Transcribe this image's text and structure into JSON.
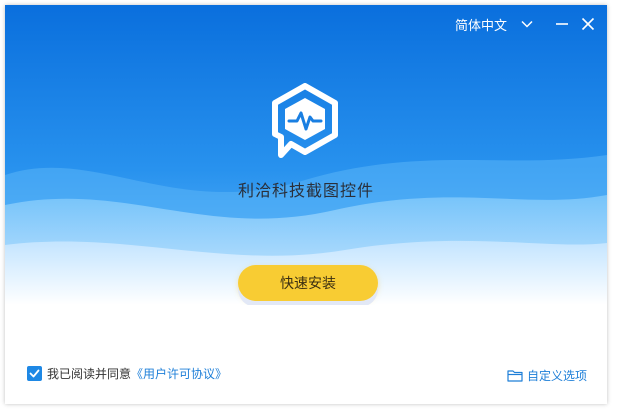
{
  "window": {
    "language_label": "简体中文"
  },
  "product": {
    "name": "利洽科技截图控件"
  },
  "actions": {
    "install_label": "快速安装",
    "custom_label": "自定义选项"
  },
  "agreement": {
    "checked": true,
    "prefix": "我已阅读并同意",
    "link_label": "《用户许可协议》"
  },
  "colors": {
    "hero_top": "#0a74e0",
    "hero_bottom": "#3ba3f4",
    "install_button": "#f8cc33",
    "link": "#1e7fd8",
    "checkbox": "#1e88e5"
  },
  "icons": {
    "language_dropdown": "chevron-down-icon",
    "minimize": "minimize-icon",
    "close": "close-icon",
    "logo": "app-logo-icon",
    "checkbox": "checkmark-icon",
    "custom": "folder-icon"
  }
}
